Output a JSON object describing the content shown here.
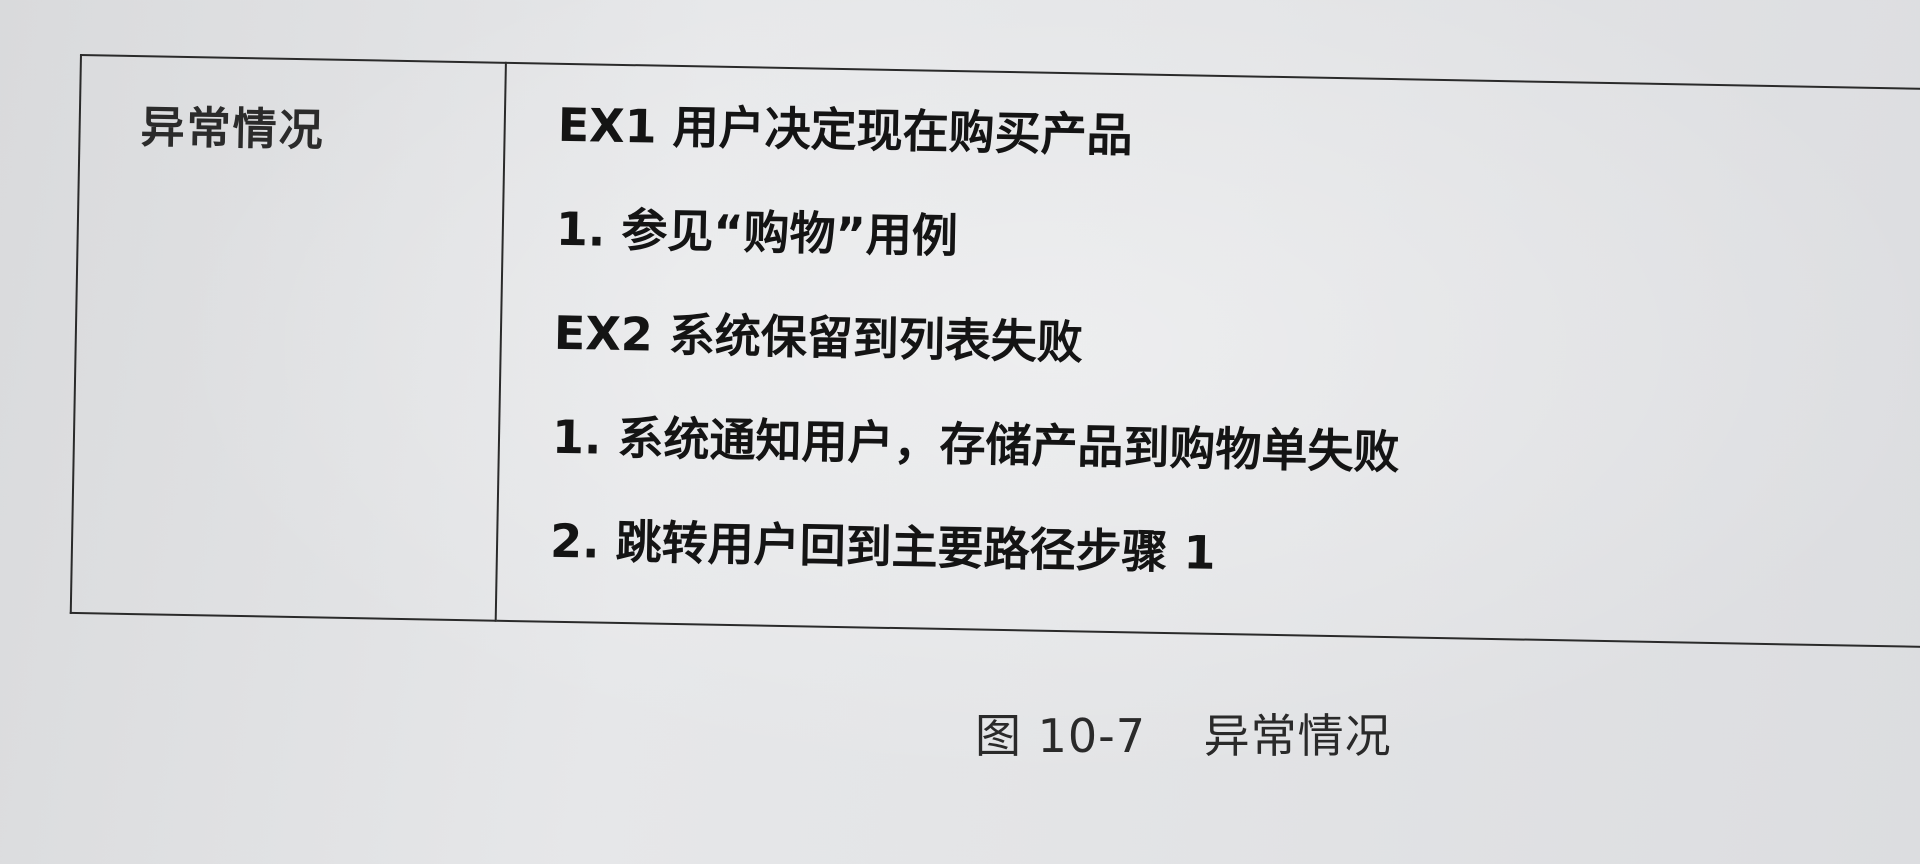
{
  "table": {
    "label": "异常情况",
    "lines": [
      "EX1 用户决定现在购买产品",
      "1. 参见“购物”用例",
      "EX2 系统保留到列表失败",
      "1. 系统通知用户，存储产品到购物单失败",
      "2. 跳转用户回到主要路径步骤 1"
    ]
  },
  "caption": {
    "number": "图 10-7",
    "title": "异常情况"
  }
}
